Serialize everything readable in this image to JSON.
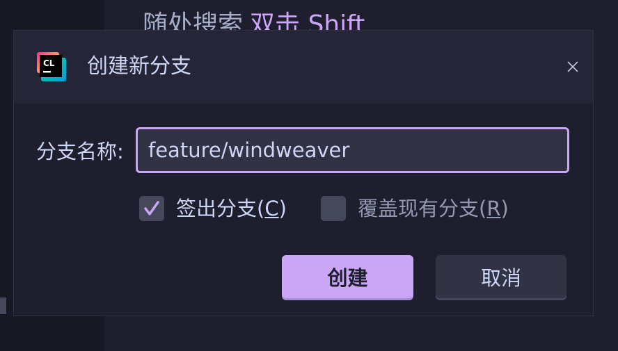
{
  "background": {
    "hint_text": "随处搜索",
    "hint_key": "双击 Shift"
  },
  "dialog": {
    "icon": "clion-app-icon",
    "icon_text": "CL",
    "title": "创建新分支",
    "close_icon": "close-icon",
    "branch_name_label": "分支名称:",
    "branch_name_value": "feature/windweaver",
    "checkout": {
      "label_prefix": "签出分支(",
      "mnemonic": "C",
      "label_suffix": ")",
      "checked": true
    },
    "overwrite": {
      "label_prefix": "覆盖现有分支(",
      "mnemonic": "R",
      "label_suffix": ")",
      "checked": false
    },
    "create_button": "创建",
    "cancel_button": "取消"
  },
  "colors": {
    "accent": "#cba6f7",
    "background": "#1e1e2e",
    "header": "#252537",
    "input_bg": "#313244",
    "text": "#cdd6f4",
    "muted_text": "#9399b2"
  }
}
